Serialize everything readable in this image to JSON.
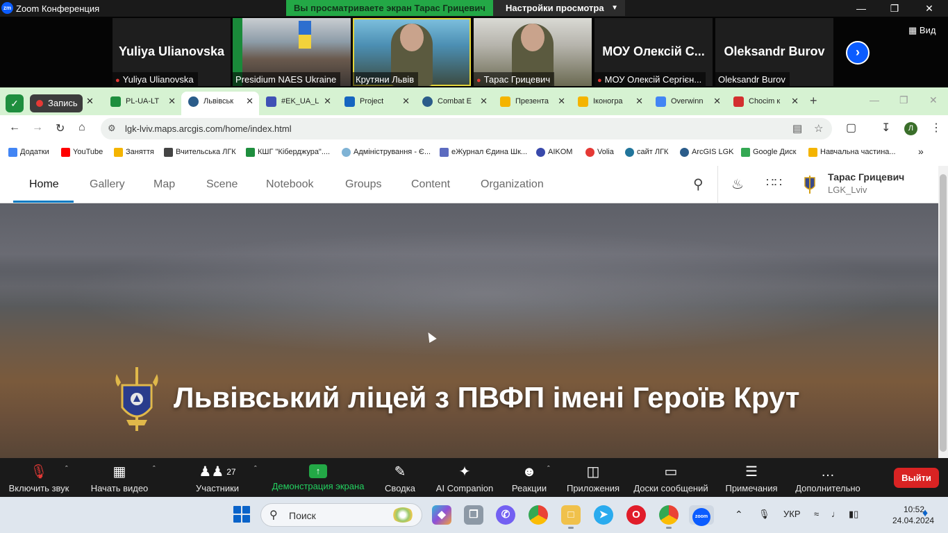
{
  "zoom": {
    "app_title": "Zoom Конференция",
    "logo_text": "zm",
    "share_banner": "Вы просматриваете экран Тарас Грицевич",
    "view_settings": "Настройки просмотра",
    "view_button": "Вид",
    "participants": [
      {
        "display": "Yuliya Ulianovska",
        "label": "Yuliya Ulianovska",
        "muted": true,
        "video": false
      },
      {
        "display": "",
        "label": "Presidium NAES Ukraine",
        "muted": false,
        "video": true
      },
      {
        "display": "",
        "label": "Крутяни Львів",
        "muted": false,
        "video": true
      },
      {
        "display": "",
        "label": "Тарас Грицевич",
        "muted": true,
        "video": true
      },
      {
        "display": "МОУ Олексій С...",
        "label": "МОУ Олексій Сергієн...",
        "muted": true,
        "video": false
      },
      {
        "display": "Oleksandr Burov",
        "label": "Oleksandr Burov",
        "muted": false,
        "video": false
      }
    ]
  },
  "browser": {
    "record_label": "Запись",
    "tabs": [
      {
        "title": "PL-UA-LT",
        "color": "#1e8e3e"
      },
      {
        "title": "Львівськ",
        "color": "#2b5c8a",
        "active": true
      },
      {
        "title": "#EK_UA_L",
        "color": "#3f51b5"
      },
      {
        "title": "Project",
        "color": "#1565c0"
      },
      {
        "title": "Combat E",
        "color": "#2b5c8a"
      },
      {
        "title": "Презента",
        "color": "#f4b400"
      },
      {
        "title": "Іконогра",
        "color": "#f4b400"
      },
      {
        "title": "Overwinn",
        "color": "#4285f4"
      },
      {
        "title": "Chocim к",
        "color": "#d32f2f"
      }
    ],
    "url": "lgk-lviv.maps.arcgis.com/home/index.html",
    "profile_initial": "Л",
    "bookmarks": [
      {
        "label": "Додатки",
        "color": "#4285f4"
      },
      {
        "label": "YouTube",
        "color": "#ff0000"
      },
      {
        "label": "Заняття",
        "color": "#f4b400"
      },
      {
        "label": "Вчительська ЛГК",
        "color": "#444444"
      },
      {
        "label": "КШГ \"Кіберджура\"....",
        "color": "#1e8e3e"
      },
      {
        "label": "Адміністрування - Є...",
        "color": "#7fb3d5"
      },
      {
        "label": "еЖурнал Єдина Шк...",
        "color": "#5c6bc0"
      },
      {
        "label": "AIKOM",
        "color": "#3949ab"
      },
      {
        "label": "Volia",
        "color": "#e53935"
      },
      {
        "label": "сайт ЛГК",
        "color": "#21759b"
      },
      {
        "label": "ArcGIS LGK",
        "color": "#2b5c8a"
      },
      {
        "label": "Google Диск",
        "color": "#34a853"
      },
      {
        "label": "Навчальна частина...",
        "color": "#f4b400"
      }
    ]
  },
  "arcgis": {
    "nav": [
      "Home",
      "Gallery",
      "Map",
      "Scene",
      "Notebook",
      "Groups",
      "Content",
      "Organization"
    ],
    "active_nav": "Home",
    "user_name": "Тарас Грицевич",
    "user_org": "LGK_Lviv",
    "hero_title": "Львівський ліцей з ПВФП імені Героїв Крут"
  },
  "controls": {
    "mute_label": "Включить звук",
    "video_label": "Начать видео",
    "participants_label": "Участники",
    "participants_count": "27",
    "share_label": "Демонстрация экрана",
    "summary_label": "Сводка",
    "ai_label": "AI Companion",
    "reactions_label": "Реакции",
    "apps_label": "Приложения",
    "whiteboards_label": "Доски сообщений",
    "notes_label": "Примечания",
    "more_label": "Дополнительно",
    "leave_label": "Выйти"
  },
  "taskbar": {
    "search_placeholder": "Поиск",
    "language": "УКР",
    "time": "10:52",
    "date": "24.04.2024"
  }
}
